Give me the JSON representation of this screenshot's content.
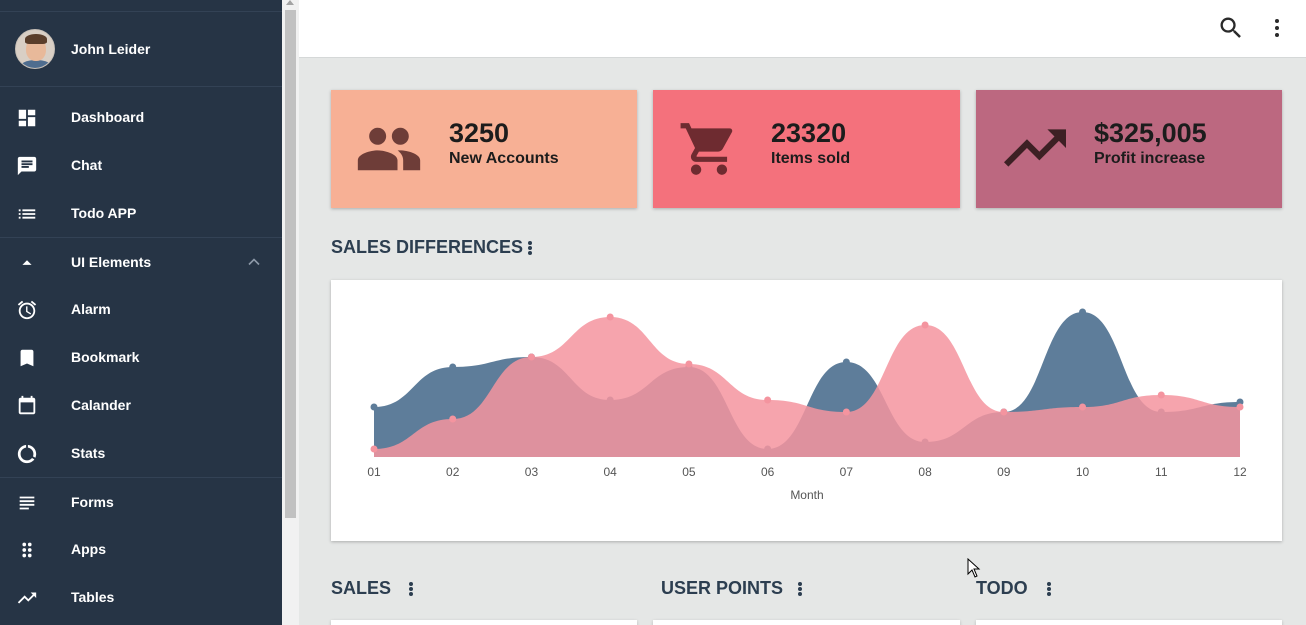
{
  "profile": {
    "name": "John Leider"
  },
  "nav": [
    {
      "label": "Dashboard",
      "icon": "dashboard-icon"
    },
    {
      "label": "Chat",
      "icon": "chat-icon"
    },
    {
      "label": "Todo APP",
      "icon": "list-icon"
    },
    {
      "label": "UI Elements",
      "icon": "arrow-up-icon"
    },
    {
      "label": "Alarm",
      "icon": "alarm-icon"
    },
    {
      "label": "Bookmark",
      "icon": "bookmark-icon"
    },
    {
      "label": "Calander",
      "icon": "calendar-icon"
    },
    {
      "label": "Stats",
      "icon": "donut-icon"
    },
    {
      "label": "Forms",
      "icon": "subject-icon"
    },
    {
      "label": "Apps",
      "icon": "apps-icon"
    },
    {
      "label": "Tables",
      "icon": "trending-up-icon"
    }
  ],
  "stats": [
    {
      "value": "3250",
      "caption": "New Accounts",
      "color": "#f7b095",
      "icon": "people-icon"
    },
    {
      "value": "23320",
      "caption": "Items sold",
      "color": "#f4717c",
      "icon": "cart-icon"
    },
    {
      "value": "$325,005",
      "caption": "Profit increase",
      "color": "#bc6880",
      "icon": "trending-up-icon"
    }
  ],
  "sections": {
    "sales_differences": "SALES DIFFERENCES",
    "sales": "SALES",
    "user_points": "USER POINTS",
    "todo": "TODO"
  },
  "chart_data": {
    "type": "area",
    "xlabel": "Month",
    "x": [
      "01",
      "02",
      "03",
      "04",
      "05",
      "06",
      "07",
      "08",
      "09",
      "10",
      "11",
      "12"
    ],
    "ylim": [
      0,
      150
    ],
    "series": [
      {
        "color": "#5e7d9a",
        "values": [
          50,
          90,
          100,
          57,
          90,
          8,
          95,
          15,
          45,
          145,
          45,
          55
        ]
      },
      {
        "color": "#f4949f",
        "values": [
          8,
          38,
          100,
          140,
          93,
          57,
          45,
          132,
          45,
          50,
          62,
          50
        ]
      }
    ]
  },
  "colors": {
    "sidebar": "#263445",
    "accent_text": "#2c3e50",
    "background": "#e5e7e6"
  }
}
